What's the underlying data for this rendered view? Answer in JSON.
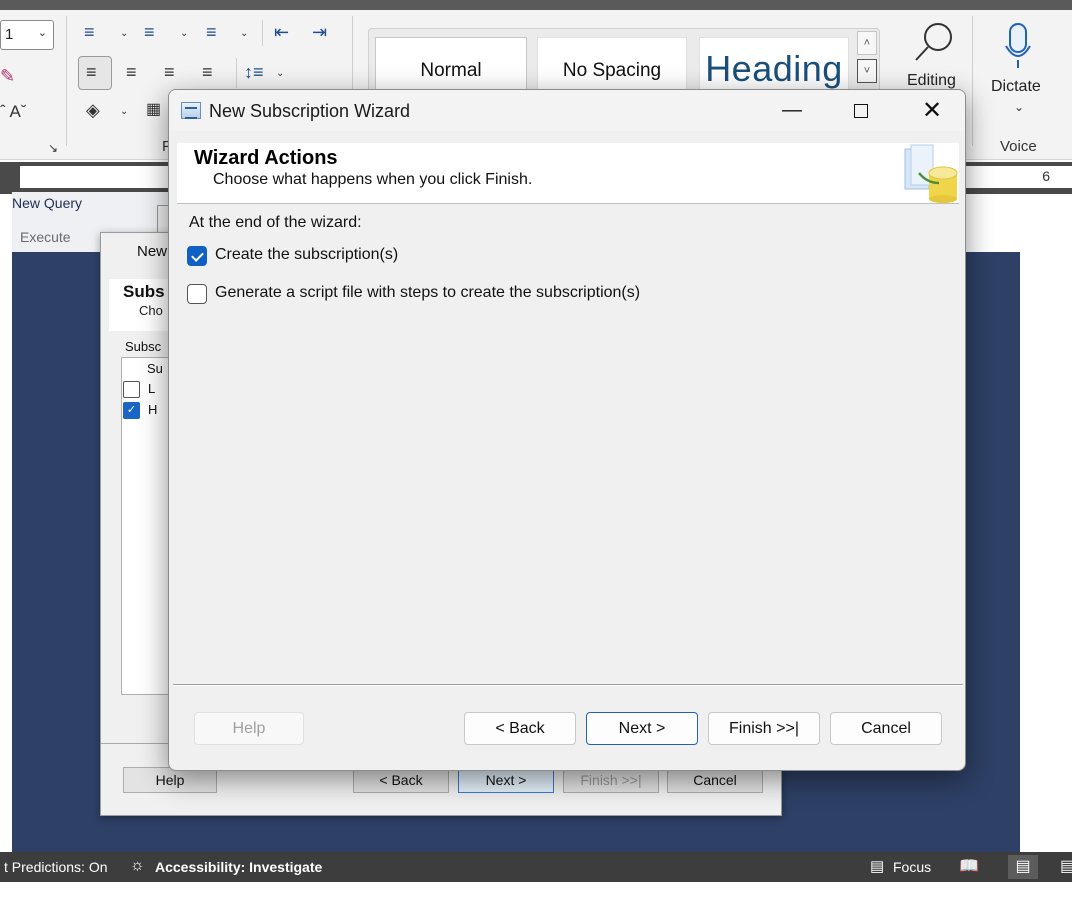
{
  "word": {
    "font_size": "1",
    "styles": [
      "Normal",
      "No Spacing",
      "Heading"
    ],
    "editing_label": "Editing",
    "dictate_label": "Dictate",
    "voice_label": "Voice",
    "paragraph_label": "P",
    "ruler_mark": "6",
    "status": {
      "predictions": "t Predictions: On",
      "accessibility": "Accessibility: Investigate",
      "focus": "Focus"
    }
  },
  "ssms": {
    "new_query": "New Query",
    "execute": "Execute",
    "back_dialog": {
      "title": "New",
      "header_title": "Subs",
      "header_sub": "Cho",
      "list_label": "Subsc",
      "column": "Su",
      "rows": [
        {
          "text": "L",
          "checked": false
        },
        {
          "text": "H",
          "checked": true
        }
      ],
      "buttons": {
        "help": "Help",
        "back": "< Back",
        "next": "Next >",
        "finish": "Finish >>|",
        "cancel": "Cancel"
      }
    }
  },
  "wizard": {
    "title": "New Subscription Wizard",
    "header": {
      "title": "Wizard Actions",
      "subtitle": "Choose what happens when you click Finish."
    },
    "section_label": "At the end of the wizard:",
    "options": [
      {
        "label": "Create the subscription(s)",
        "checked": true
      },
      {
        "label": "Generate a script file with steps to create the subscription(s)",
        "checked": false
      }
    ],
    "buttons": {
      "help": "Help",
      "back": "< Back",
      "next": "Next >",
      "finish": "Finish >>|",
      "cancel": "Cancel"
    }
  }
}
